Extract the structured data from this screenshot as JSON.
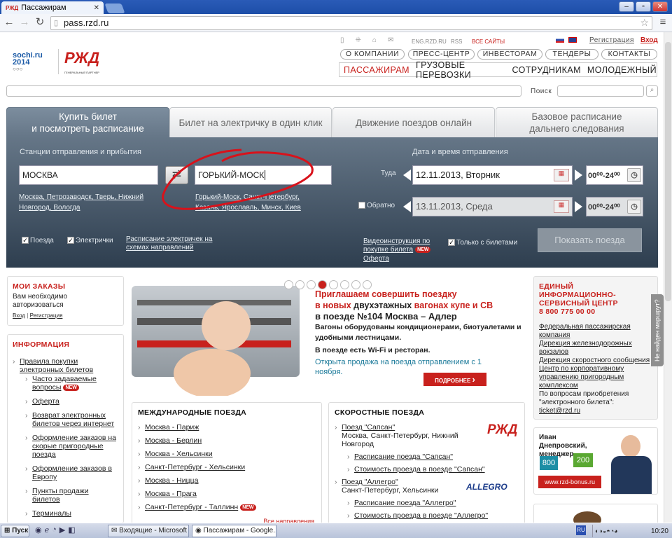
{
  "browser": {
    "tab_title": "Пассажирам",
    "url": "pass.rzd.ru"
  },
  "header": {
    "small_links": [
      "ENG.RZD.RU",
      "RSS",
      "ВСЕ САЙТЫ"
    ],
    "register": "Регистрация",
    "login": "Вход",
    "top_pills": [
      "О КОМПАНИИ",
      "ПРЕСС-ЦЕНТР",
      "ИНВЕСТОРАМ",
      "ТЕНДЕРЫ",
      "КОНТАКТЫ"
    ],
    "main_nav": [
      "ПАССАЖИРАМ",
      "ГРУЗОВЫЕ ПЕРЕВОЗКИ",
      "СОТРУДНИКАМ",
      "МОЛОДЕЖНЫЙ"
    ],
    "sochi_logo": "sochi.ru 2014",
    "rzd_logo": "РЖД",
    "partner_caption": "ГЕНЕРАЛЬНЫЙ ПАРТНЕР",
    "search_label": "Поиск"
  },
  "tabs": [
    {
      "label": "Купить билет\nи посмотреть расписание",
      "active": true
    },
    {
      "label": "Билет на электричку в один клик",
      "active": false
    },
    {
      "label": "Движение поездов онлайн",
      "active": false
    },
    {
      "label": "Базовое расписание\nдальнего следования",
      "active": false
    }
  ],
  "form": {
    "stations_label": "Станции отправления и прибытия",
    "from_value": "МОСКВА",
    "to_value": "ГОРЬКИЙ-МОСК",
    "from_suggest": "Москва, Петрозаводск, Тверь, Нижний Новгород, Вологда",
    "to_suggest": "Горький-Моск, Санкт-Петербург, Казань, Ярославль, Минск, Киев",
    "datetime_label": "Дата и время отправления",
    "there_label": "Туда",
    "there_date": "12.11.2013, Вторник",
    "back_label": "Обратно",
    "back_date": "13.11.2013, Среда",
    "time_range": "00⁰⁰-24⁰⁰",
    "trains_label": "Поезда",
    "elec_label": "Электрички",
    "elec_schedule_link": "Расписание электричек на схемах направлений",
    "video_link": "Видеоинструкция по покупке билета",
    "offer_link": "Оферта",
    "only_tickets": "Только с билетами",
    "show_button": "Показать поезда",
    "new_badge": "NEW"
  },
  "orders": {
    "title": "МОИ ЗАКАЗЫ",
    "text": "Вам необходимо авторизоваться",
    "login": "Вход",
    "register": "Регистрация"
  },
  "info": {
    "title": "ИНФОРМАЦИЯ",
    "top_item": "Правила покупки электронных билетов",
    "items": [
      "Часто задаваемые вопросы",
      "Оферта",
      "Возврат электронных билетов через интернет",
      "Оформление заказов на скорые пригородные поезда",
      "Оформление заказов в Европу",
      "Пункты продажи билетов",
      "Терминалы"
    ]
  },
  "banner": {
    "line1": "Приглашаем совершить поездку",
    "line2a": "в новых ",
    "line2b": "двухэтажных",
    "line2c": " вагонах купе и СВ",
    "line3": "в поезде №104 Москва – Адлер",
    "line4": "Вагоны оборудованы кондиционерами, биотуалетами и удобными лестницами.",
    "line5": "В поезде есть Wi-Fi и ресторан.",
    "line6": "Открыта продажа на поезда отправлением с 1 ноября.",
    "more": "ПОДРОБНЕЕ",
    "dots": 8,
    "active_dot": 3
  },
  "intl": {
    "title": "МЕЖДУНАРОДНЫЕ ПОЕЗДА",
    "items": [
      "Москва - Париж",
      "Москва - Берлин",
      "Москва - Хельсинки",
      "Санкт-Петербург - Хельсинки",
      "Москва - Ницца",
      "Москва - Прага",
      "Санкт-Петербург - Таллинн"
    ],
    "all": "Все направления"
  },
  "fast": {
    "title": "СКОРОСТНЫЕ ПОЕЗДА",
    "sapsan": "Поезд \"Сапсан\"",
    "sapsan_desc": "Москва, Санкт-Петербург, Нижний Новгород",
    "sapsan_links": [
      "Расписание поезда \"Сапсан\"",
      "Стоимость проезда в поезде \"Сапсан\""
    ],
    "allegro": "Поезд \"Аллегро\"",
    "allegro_desc": "Санкт-Петербург, Хельсинки",
    "allegro_logo": "ALLEGRO",
    "allegro_links": [
      "Расписание поезда \"Аллегро\"",
      "Стоимость проезда в поезде \"Аллегро\""
    ]
  },
  "service": {
    "title": "ЕДИНЫЙ ИНФОРМАЦИОННО-СЕРВИСНЫЙ ЦЕНТР",
    "phone": "8 800 775 00 00",
    "links": [
      "Федеральная пассажирская компания",
      "Дирекция железнодорожных вокзалов",
      "Дирекция скоростного сообщения",
      "Центр по корпоративному управлению пригородным комплексом"
    ],
    "note": "По вопросам приобретения \"электронного билета\":",
    "email": "ticket@rzd.ru",
    "side_tab": "Не найден маршрут?"
  },
  "promo": {
    "name": "Иван Днепровский, менеджер",
    "n1": "800",
    "n2": "200",
    "site": "www.rzd-bonus.ru"
  },
  "taskbar": {
    "start": "Пуск",
    "items": [
      "Входящие - Microsoft O...",
      "Пассажирам - Google..."
    ],
    "lang": "RU",
    "clock": "10:20"
  },
  "colors": {
    "accent": "#c8211d",
    "panel": "#3f5063"
  }
}
